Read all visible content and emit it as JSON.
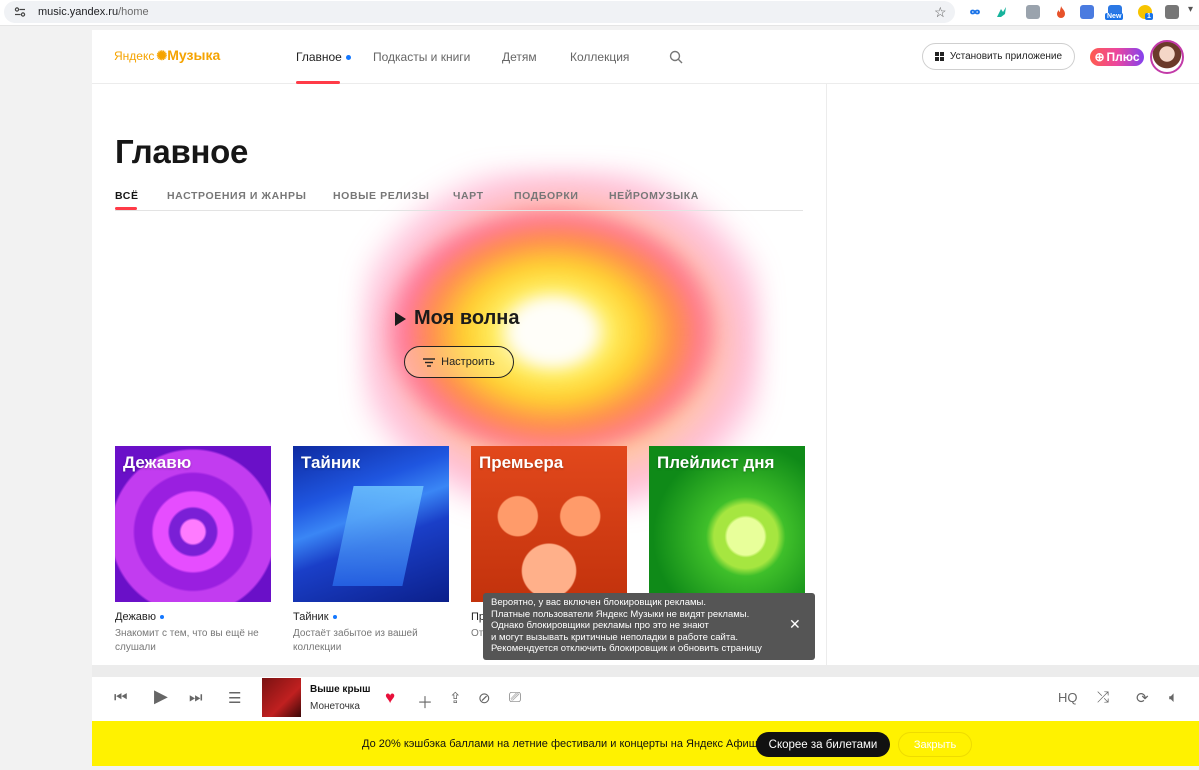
{
  "browser": {
    "url_host": "music.yandex.ru",
    "url_path": "/home",
    "extensions": [
      "infinity-icon",
      "hummingbird-icon",
      "bookmark-icon",
      "fire-icon",
      "translate-icon",
      "new-badge-icon",
      "gear-badge-icon",
      "puzzle-icon",
      "menu-chevron-icon"
    ],
    "ext_badge_new": "New",
    "ext_badge_count": "1"
  },
  "header": {
    "logo_ya": "Яндекс",
    "logo_music": "Музыка",
    "nav": [
      "Главное",
      "Подкасты и книги",
      "Детям",
      "Коллекция"
    ],
    "install_label": "Установить приложение",
    "plus_label": "Плюс"
  },
  "main": {
    "title": "Главное",
    "tabs": [
      "ВСЁ",
      "НАСТРОЕНИЯ И ЖАНРЫ",
      "НОВЫЕ РЕЛИЗЫ",
      "ЧАРТ",
      "ПОДБОРКИ",
      "НЕЙРОМУЗЫКА"
    ],
    "wave_title": "Моя волна",
    "tune_label": "Настроить"
  },
  "cards": [
    {
      "cover_title": "Дежавю",
      "name": "Дежавю",
      "desc": "Знакомит с тем, что вы ещё не слушали"
    },
    {
      "cover_title": "Тайник",
      "name": "Тайник",
      "desc": "Достаёт забытое из вашей коллекции"
    },
    {
      "cover_title": "Премьера",
      "name": "Пр",
      "desc": "От"
    },
    {
      "cover_title": "Плейлист дня",
      "name": "",
      "desc": ""
    }
  ],
  "toast": {
    "lines": [
      "Вероятно, у вас включен блокировщик рекламы.",
      "Платные пользователи Яндекс Музыки не видят рекламы.",
      "Однако блокировщики рекламы про это не знают",
      "и могут вызывать критичные неполадки в работе сайта.",
      "Рекомендуется отключить блокировщик и обновить страницу"
    ]
  },
  "player": {
    "track_title": "Выше крыш",
    "artist": "Монеточка",
    "hq_label": "HQ"
  },
  "banner": {
    "text": "До 20% кэшбэка баллами на летние фестивали и концерты на Яндекс Афише",
    "cta_label": "Скорее за билетами",
    "close_label": "Закрыть"
  },
  "colors": {
    "accent_red": "#ff3b47",
    "brand_yellow": "#f5a300",
    "banner_yellow": "#fff200",
    "like_red": "#e8103a"
  }
}
